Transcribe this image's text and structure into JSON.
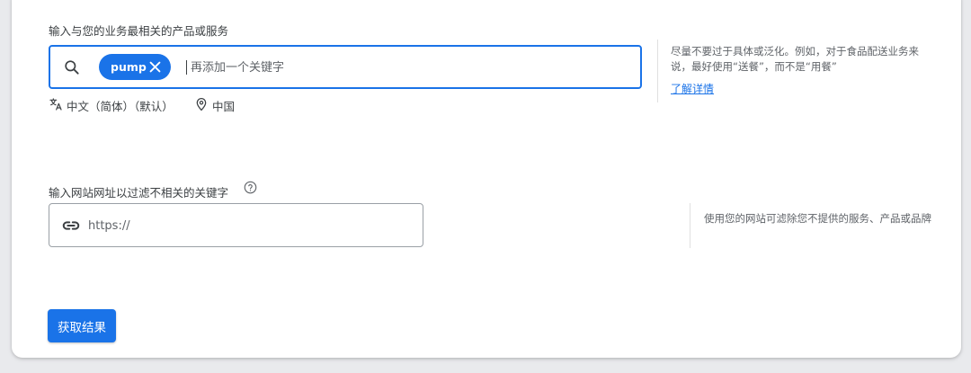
{
  "keyword_section": {
    "label": "输入与您的业务最相关的产品或服务",
    "chip_label": "pump",
    "input_placeholder": "再添加一个关键字",
    "language": "中文（简体）（默认）",
    "location": "中国",
    "hint": "尽量不要过于具体或泛化。例如，对于食品配送业务来说，最好使用“送餐”，而不是“用餐”",
    "learn_more": "了解详情"
  },
  "website_section": {
    "label": "输入网站网址以过滤不相关的关键字",
    "input_placeholder": "https://",
    "hint": "使用您的网站可滤除您不提供的服务、产品或品牌"
  },
  "actions": {
    "submit_label": "获取结果"
  },
  "colors": {
    "accent": "#1a73e8",
    "text": "#3c4043",
    "muted": "#5f6368",
    "page_background": "#e9eaed"
  },
  "icons": {
    "search": "search-icon",
    "chip_remove": "close-icon",
    "language": "translate-icon",
    "location": "location-pin-icon",
    "help": "help-circle-icon",
    "url": "link-icon"
  }
}
